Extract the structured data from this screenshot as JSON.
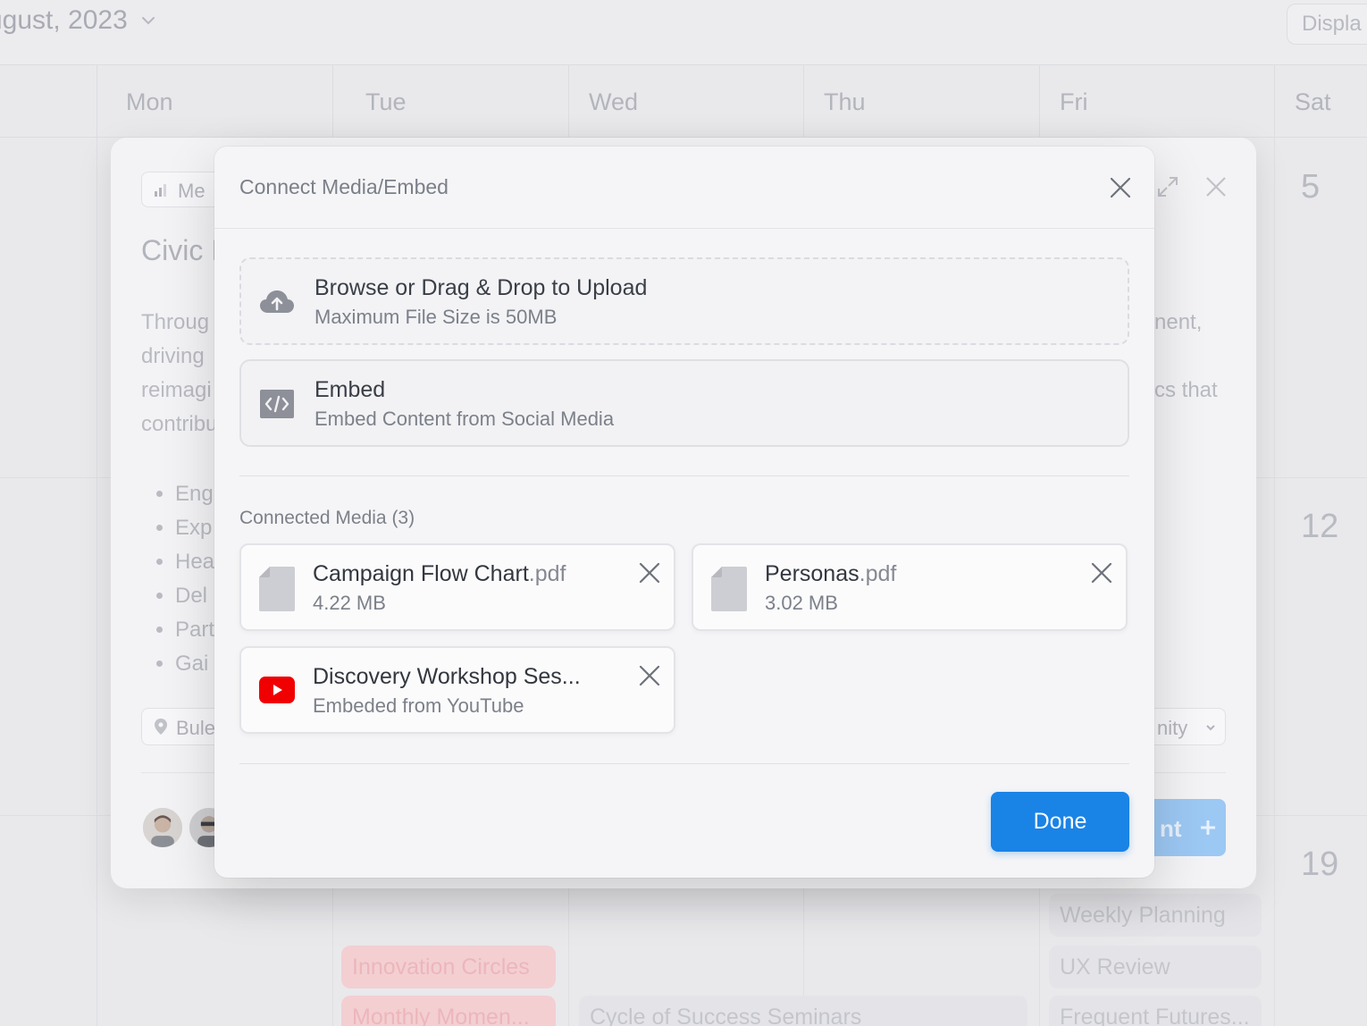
{
  "calendar": {
    "month_label": "ugust, 2023",
    "display_label": "Displa",
    "days": [
      "Mon",
      "Tue",
      "Wed",
      "Thu",
      "Fri",
      "Sat"
    ],
    "dates": [
      "5",
      "12",
      "19"
    ],
    "events": {
      "innovation_circles": "Innovation Circles",
      "monthly_momentum": "Monthly Momen...",
      "cycle_of_success": "Cycle of Success Seminars",
      "weekly_planning": "Weekly Planning",
      "ux_review": "UX Review",
      "frequent_futures": "Frequent Futures..."
    }
  },
  "event_card": {
    "tag": "Me",
    "title": "Civic I",
    "description_lines": [
      "Throug",
      "driving",
      "reimagi",
      "contribu"
    ],
    "description_right_lines": [
      "nent,",
      "",
      "cs that"
    ],
    "bullets": [
      "Eng",
      "Exp",
      "Hea",
      "Del",
      "Part",
      "Gai"
    ],
    "location": "Bule",
    "category": "nity",
    "submit_label": "nt"
  },
  "modal": {
    "title": "Connect Media/Embed",
    "upload": {
      "title": "Browse or Drag & Drop to Upload",
      "subtitle": "Maximum File Size is 50MB"
    },
    "embed": {
      "title": "Embed",
      "subtitle": "Embed Content from Social Media"
    },
    "connected_label": "Connected Media (3)",
    "media": [
      {
        "name": "Campaign Flow Chart",
        "ext": ".pdf",
        "meta": "4.22 MB",
        "icon": "file-icon"
      },
      {
        "name": "Personas",
        "ext": ".pdf",
        "meta": "3.02 MB",
        "icon": "file-icon"
      },
      {
        "name": "Discovery Workshop Ses...",
        "ext": "",
        "meta": "Embeded from YouTube",
        "icon": "youtube-icon"
      }
    ],
    "done_label": "Done"
  },
  "colors": {
    "accent": "#1a83e6",
    "youtube_red": "#f00000",
    "modal_bg": "#f5f5f7",
    "background": "#e9e9ec"
  }
}
